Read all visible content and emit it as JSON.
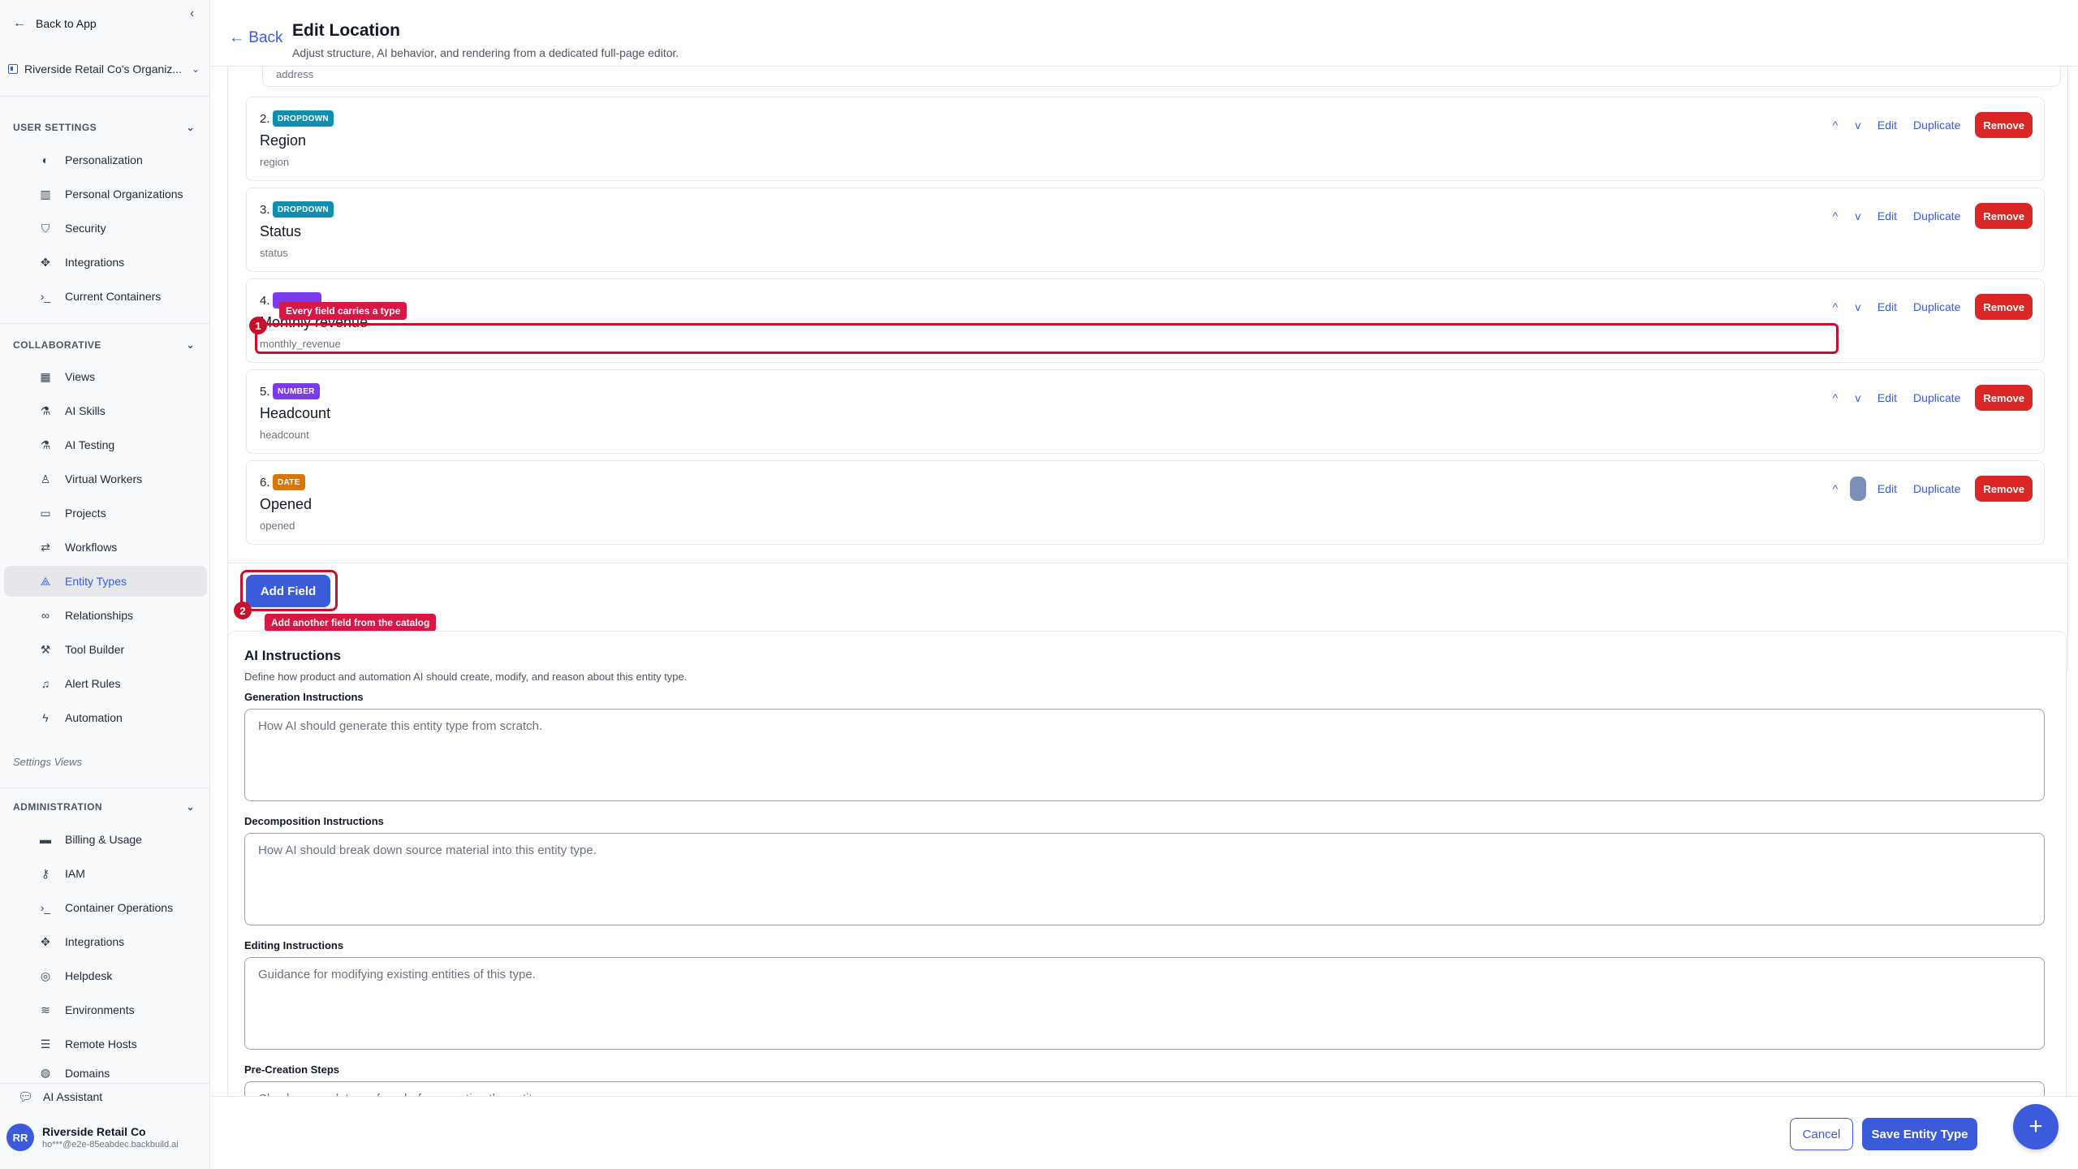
{
  "sidebar": {
    "back_label": "Back to App",
    "org_name": "Riverside Retail Co's Organiz...",
    "sections": {
      "user_settings": "USER SETTINGS",
      "collaborative": "COLLABORATIVE",
      "administration": "ADMINISTRATION"
    },
    "user_items": [
      "Personalization",
      "Personal Organizations",
      "Security",
      "Integrations",
      "Current Containers"
    ],
    "collab_items": [
      "Views",
      "AI Skills",
      "AI Testing",
      "Virtual Workers",
      "Projects",
      "Workflows",
      "Entity Types",
      "Relationships",
      "Tool Builder",
      "Alert Rules",
      "Automation"
    ],
    "settings_views": "Settings Views",
    "admin_items": [
      "Billing & Usage",
      "IAM",
      "Container Operations",
      "Integrations",
      "Helpdesk",
      "Environments",
      "Remote Hosts",
      "Domains"
    ],
    "ai_assistant": "AI Assistant",
    "user": {
      "initials": "RR",
      "name": "Riverside Retail Co",
      "email": "ho***@e2e-85eabdec.backbuild.ai"
    }
  },
  "header": {
    "back": "← Back",
    "title": "Edit Location",
    "subtitle": "Adjust structure, AI behavior, and rendering from a dedicated full-page editor."
  },
  "fields": {
    "first_key": "address",
    "rows": [
      {
        "num": "2.",
        "type": "DROPDOWN",
        "label": "Region",
        "key": "region",
        "color": "#0e8fb0"
      },
      {
        "num": "3.",
        "type": "DROPDOWN",
        "label": "Status",
        "key": "status",
        "color": "#0e8fb0"
      },
      {
        "num": "4.",
        "type": "",
        "label": "Monthly revenue",
        "key": "monthly_revenue",
        "color": "#7c3aed"
      },
      {
        "num": "5.",
        "type": "NUMBER",
        "label": "Headcount",
        "key": "headcount",
        "color": "#7c3aed"
      },
      {
        "num": "6.",
        "type": "DATE",
        "label": "Opened",
        "key": "opened",
        "color": "#d97706"
      }
    ],
    "actions": {
      "up": "^",
      "down": "v",
      "edit": "Edit",
      "duplicate": "Duplicate",
      "remove": "Remove"
    },
    "add_field": "Add Field"
  },
  "tour": {
    "step1_num": "1",
    "step1_text": "Every field carries a type",
    "step2_num": "2",
    "step2_text": "Add another field from the catalog"
  },
  "ai": {
    "title": "AI Instructions",
    "description": "Define how product and automation AI should create, modify, and reason about this entity type.",
    "generation_label": "Generation Instructions",
    "generation_placeholder": "How AI should generate this entity type from scratch.",
    "decomposition_label": "Decomposition Instructions",
    "decomposition_placeholder": "How AI should break down source material into this entity type.",
    "editing_label": "Editing Instructions",
    "editing_placeholder": "Guidance for modifying existing entities of this type.",
    "precreation_label": "Pre-Creation Steps",
    "precreation_placeholder": "Checks or work to perform before creating the entity."
  },
  "footer": {
    "cancel": "Cancel",
    "save": "Save Entity Type",
    "fab": "+"
  },
  "colors": {
    "accent": "#3b5bdb",
    "danger": "#dc2626",
    "highlight": "#c8102e"
  }
}
